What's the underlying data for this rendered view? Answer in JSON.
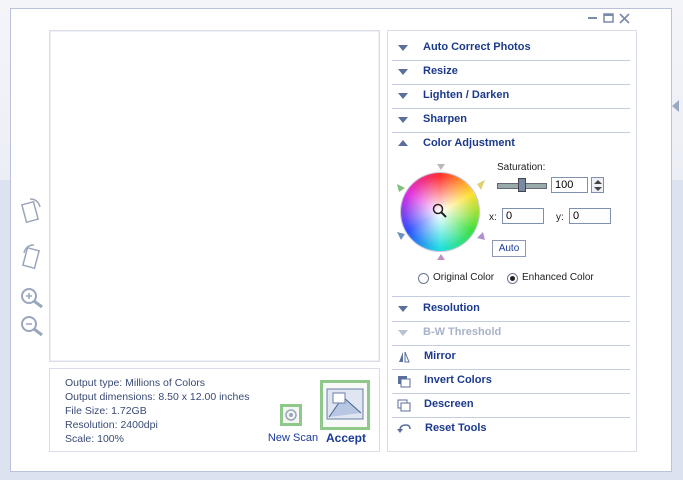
{
  "window": {
    "controls": [
      "minimize",
      "maximize",
      "close"
    ]
  },
  "info": {
    "output_type": "Output type: Millions of Colors",
    "output_dimensions": "Output dimensions: 8.50 x 12.00 inches",
    "file_size": "File Size: 1.72GB",
    "resolution": "Resolution:  2400dpi",
    "scale": "Scale: 100%"
  },
  "actions": {
    "new_scan_label": "New Scan",
    "accept_label": "Accept"
  },
  "panel": {
    "auto_correct": "Auto Correct Photos",
    "resize": "Resize",
    "lighten_darken": "Lighten / Darken",
    "sharpen": "Sharpen",
    "color_adjustment": "Color Adjustment",
    "resolution": "Resolution",
    "bw_threshold": "B-W Threshold",
    "mirror": "Mirror",
    "invert_colors": "Invert Colors",
    "descreen": "Descreen",
    "reset_tools": "Reset Tools"
  },
  "color_adjustment": {
    "saturation_label": "Saturation:",
    "saturation_value": "100",
    "saturation_level": 0.5,
    "x_label": "x:",
    "x_value": "0",
    "y_label": "y:",
    "y_value": "0",
    "auto_label": "Auto",
    "original_color_label": "Original Color",
    "enhanced_color_label": "Enhanced Color",
    "selected_mode": "Enhanced Color"
  },
  "colors": {
    "accent": "#1c3a8c",
    "accept_border": "#8fc98a",
    "disabled": "#a8b2c8"
  }
}
